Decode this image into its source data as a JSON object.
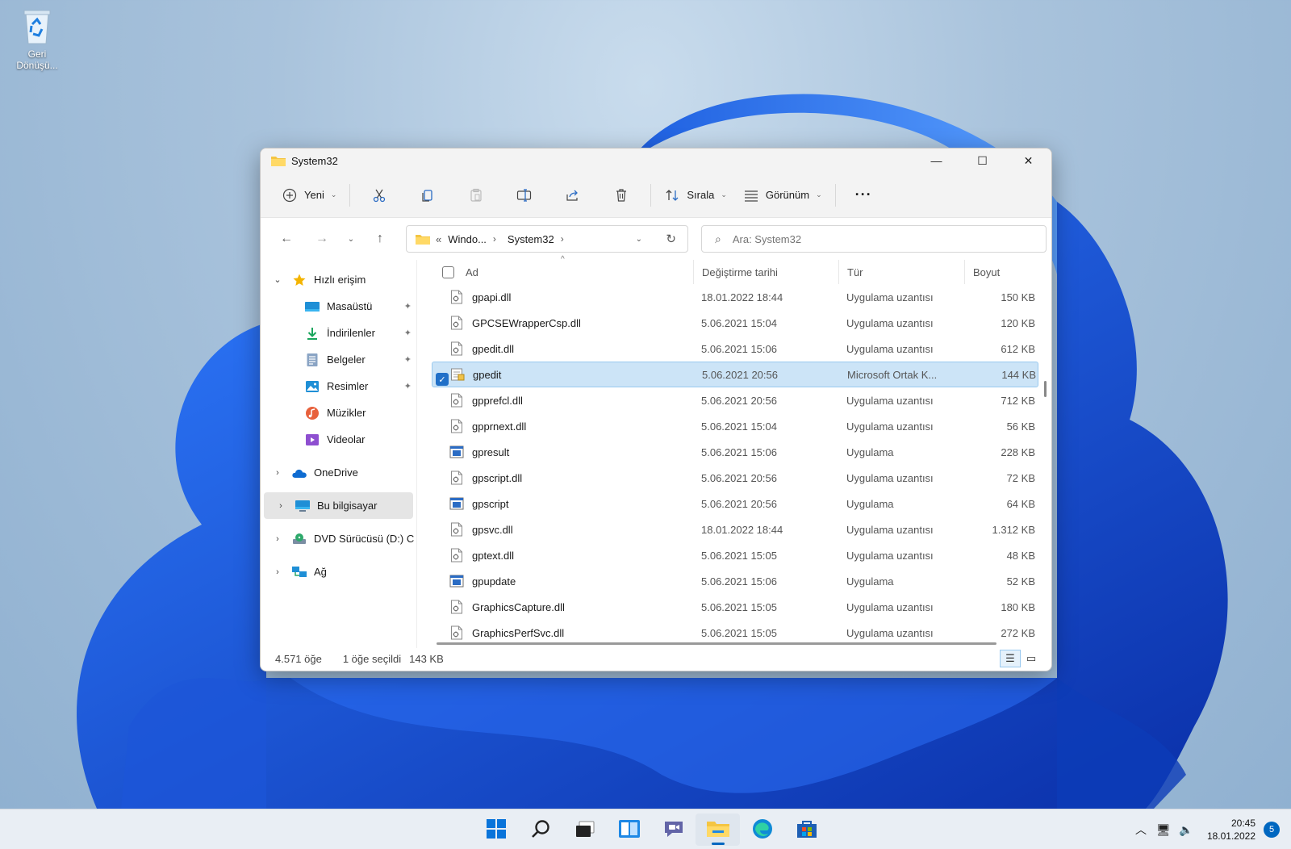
{
  "desktop": {
    "recycle_bin_label": "Geri Dönüşü..."
  },
  "window": {
    "title": "System32",
    "controls": {
      "minimize": "—",
      "maximize": "☐",
      "close": "✕"
    }
  },
  "commandbar": {
    "new_label": "Yeni",
    "sort_label": "Sırala",
    "view_label": "Görünüm",
    "more_label": "···"
  },
  "navigation": {
    "address_overflow": "«",
    "address_segment_1": "Windo...",
    "address_segment_2": "System32",
    "search_placeholder": "Ara: System32"
  },
  "sidebar": {
    "quick_access": "Hızlı erişim",
    "items": [
      {
        "label": "Masaüstü"
      },
      {
        "label": "İndirilenler"
      },
      {
        "label": "Belgeler"
      },
      {
        "label": "Resimler"
      },
      {
        "label": "Müzikler"
      },
      {
        "label": "Videolar"
      }
    ],
    "onedrive": "OneDrive",
    "this_pc": "Bu bilgisayar",
    "dvd": "DVD Sürücüsü (D:) C",
    "network": "Ağ"
  },
  "columns": {
    "name": "Ad",
    "date": "Değiştirme tarihi",
    "type": "Tür",
    "size": "Boyut"
  },
  "files": [
    {
      "name": "gpapi.dll",
      "date": "18.01.2022 18:44",
      "type": "Uygulama uzantısı",
      "size": "150 KB",
      "icon": "dll-icon"
    },
    {
      "name": "GPCSEWrapperCsp.dll",
      "date": "5.06.2021 15:04",
      "type": "Uygulama uzantısı",
      "size": "120 KB",
      "icon": "dll-icon"
    },
    {
      "name": "gpedit.dll",
      "date": "5.06.2021 15:06",
      "type": "Uygulama uzantısı",
      "size": "612 KB",
      "icon": "dll-icon"
    },
    {
      "name": "gpedit",
      "date": "5.06.2021 20:56",
      "type": "Microsoft Ortak K...",
      "size": "144 KB",
      "icon": "msc-icon",
      "selected": true
    },
    {
      "name": "gpprefcl.dll",
      "date": "5.06.2021 20:56",
      "type": "Uygulama uzantısı",
      "size": "712 KB",
      "icon": "dll-icon"
    },
    {
      "name": "gpprnext.dll",
      "date": "5.06.2021 15:04",
      "type": "Uygulama uzantısı",
      "size": "56 KB",
      "icon": "dll-icon"
    },
    {
      "name": "gpresult",
      "date": "5.06.2021 15:06",
      "type": "Uygulama",
      "size": "228 KB",
      "icon": "exe-icon"
    },
    {
      "name": "gpscript.dll",
      "date": "5.06.2021 20:56",
      "type": "Uygulama uzantısı",
      "size": "72 KB",
      "icon": "dll-icon"
    },
    {
      "name": "gpscript",
      "date": "5.06.2021 20:56",
      "type": "Uygulama",
      "size": "64 KB",
      "icon": "exe-icon"
    },
    {
      "name": "gpsvc.dll",
      "date": "18.01.2022 18:44",
      "type": "Uygulama uzantısı",
      "size": "1.312 KB",
      "icon": "dll-icon"
    },
    {
      "name": "gptext.dll",
      "date": "5.06.2021 15:05",
      "type": "Uygulama uzantısı",
      "size": "48 KB",
      "icon": "dll-icon"
    },
    {
      "name": "gpupdate",
      "date": "5.06.2021 15:06",
      "type": "Uygulama",
      "size": "52 KB",
      "icon": "exe-icon"
    },
    {
      "name": "GraphicsCapture.dll",
      "date": "5.06.2021 15:05",
      "type": "Uygulama uzantısı",
      "size": "180 KB",
      "icon": "dll-icon"
    },
    {
      "name": "GraphicsPerfSvc.dll",
      "date": "5.06.2021 15:05",
      "type": "Uygulama uzantısı",
      "size": "272 KB",
      "icon": "dll-icon"
    }
  ],
  "status": {
    "item_count": "4.571 öğe",
    "selected": "1 öğe seçildi",
    "selected_size": "143 KB"
  },
  "taskbar": {
    "time": "20:45",
    "date": "18.01.2022",
    "notification_count": "5"
  },
  "colors": {
    "accent": "#0067c0",
    "selection": "#cce4f7",
    "folder": "#f4c542"
  }
}
